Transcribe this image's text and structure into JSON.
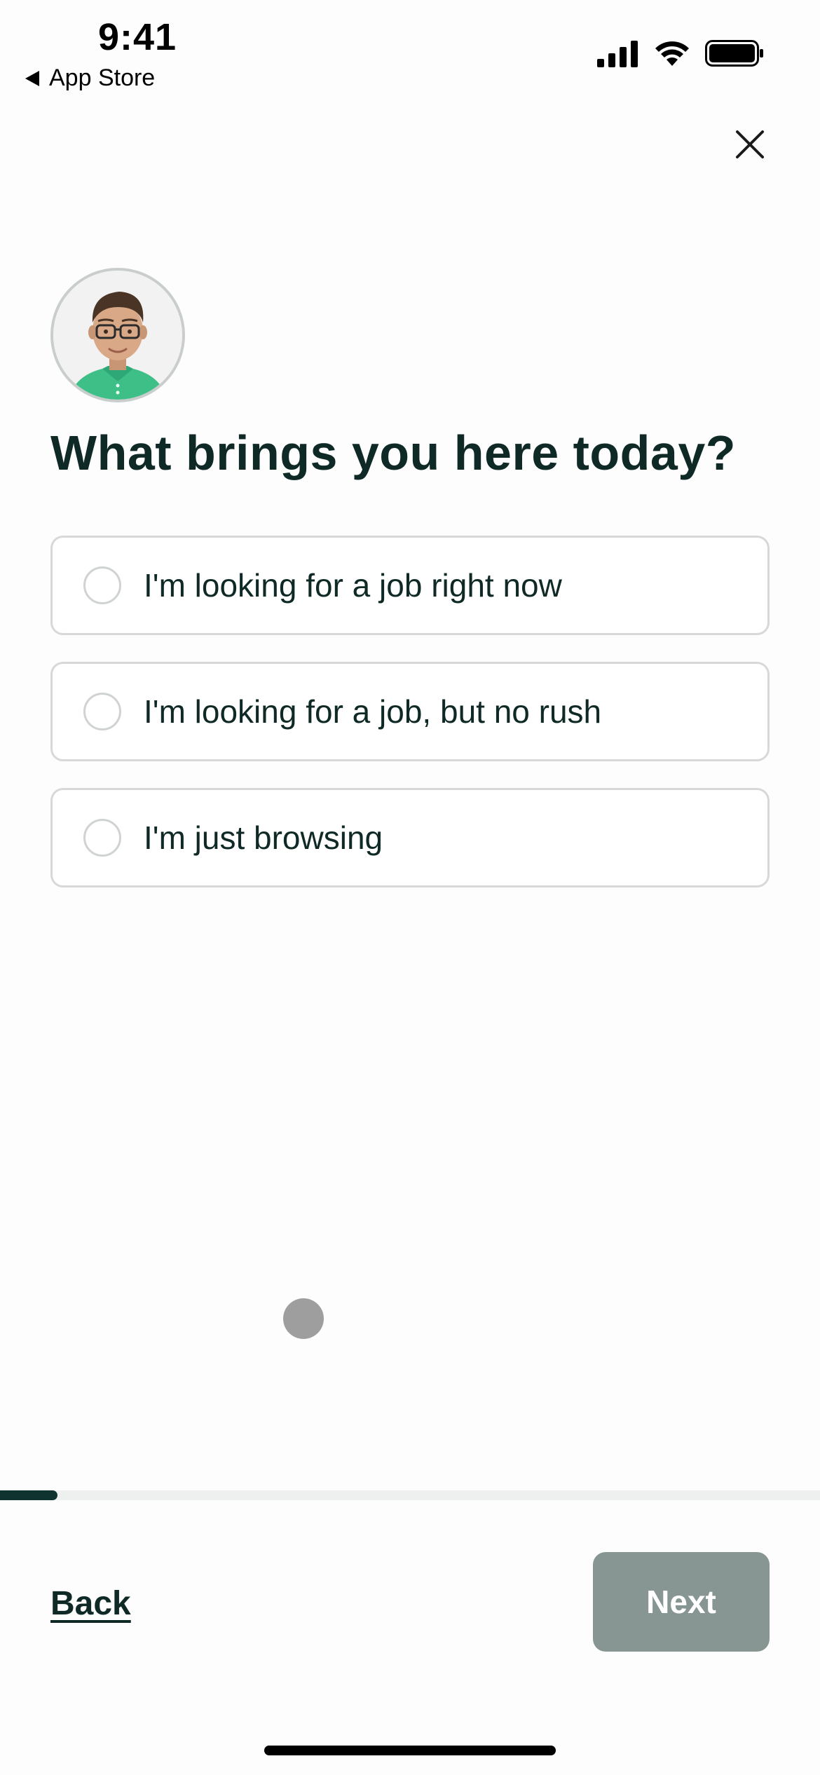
{
  "status_bar": {
    "time": "9:41",
    "back_app_label": "App Store",
    "icons": [
      "cellular-signal-icon",
      "wifi-icon",
      "battery-icon"
    ]
  },
  "header": {
    "close_icon": "close-icon"
  },
  "question": {
    "title": "What brings you here today?",
    "options": [
      {
        "label": "I'm looking for a job right now",
        "selected": false
      },
      {
        "label": "I'm looking for a job, but no rush",
        "selected": false
      },
      {
        "label": "I'm just browsing",
        "selected": false
      }
    ]
  },
  "progress": {
    "fraction": 0.07
  },
  "footer": {
    "back_label": "Back",
    "next_label": "Next",
    "next_enabled": false
  },
  "colors": {
    "accent": "#0f3430",
    "text": "#0f2a26",
    "next_disabled": "#879593",
    "border": "#d6d9d8"
  }
}
